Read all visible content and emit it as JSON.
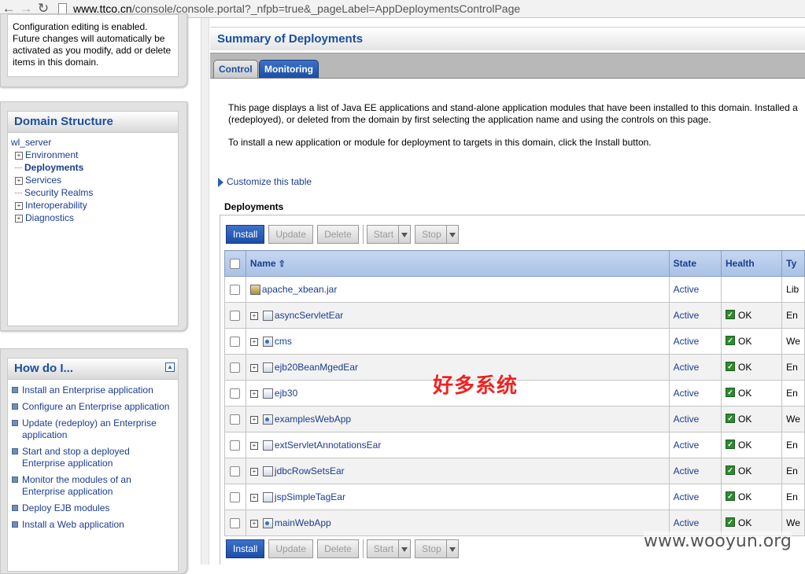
{
  "browser": {
    "back_icon": "arrow-left-icon",
    "forward_icon": "arrow-right-icon",
    "reload_icon": "reload-icon",
    "url_host": "www.ttco.cn",
    "url_path": "/console/console.portal?_nfpb=true&_pageLabel=AppDeploymentsControlPage"
  },
  "change_center": {
    "text": "Configuration editing is enabled. Future changes will automatically be activated as you modify, add or delete items in this domain."
  },
  "domain_structure": {
    "title": "Domain Structure",
    "root": "wl_server",
    "items": [
      {
        "label": "Environment",
        "expandable": true
      },
      {
        "label": "Deployments",
        "expandable": false,
        "selected": true
      },
      {
        "label": "Services",
        "expandable": true
      },
      {
        "label": "Security Realms",
        "expandable": false
      },
      {
        "label": "Interoperability",
        "expandable": true
      },
      {
        "label": "Diagnostics",
        "expandable": true
      }
    ]
  },
  "how_do_i": {
    "title": "How do I...",
    "items": [
      "Install an Enterprise application",
      "Configure an Enterprise application",
      "Update (redeploy) an Enterprise application",
      "Start and stop a deployed Enterprise application",
      "Monitor the modules of an Enterprise application",
      "Deploy EJB modules",
      "Install a Web application"
    ]
  },
  "main": {
    "title": "Summary of Deployments",
    "tabs": [
      {
        "label": "Control",
        "active": false
      },
      {
        "label": "Monitoring",
        "active": true
      }
    ],
    "intro_line1": "This page displays a list of Java EE applications and stand-alone application modules that have been installed to this domain. Installed a",
    "intro_line2": "(redeployed), or deleted from the domain by first selecting the application name and using the controls on this page.",
    "intro_line3": "To install a new application or module for deployment to targets in this domain, click the Install button.",
    "customize_link": "Customize this table",
    "table_caption": "Deployments"
  },
  "toolbar": {
    "install": "Install",
    "update": "Update",
    "delete": "Delete",
    "start": "Start",
    "stop": "Stop"
  },
  "table": {
    "columns": {
      "name": "Name",
      "state": "State",
      "health": "Health",
      "type": "Ty"
    },
    "rows": [
      {
        "name": "apache_xbean.jar",
        "state": "Active",
        "health": "",
        "type": "Lib",
        "expandable": false,
        "icon": "library-icon"
      },
      {
        "name": "asyncServletEar",
        "state": "Active",
        "health": "OK",
        "type": "En",
        "expandable": true,
        "icon": "enterprise-app-icon"
      },
      {
        "name": "cms",
        "state": "Active",
        "health": "OK",
        "type": "We",
        "expandable": true,
        "icon": "web-app-icon"
      },
      {
        "name": "ejb20BeanMgedEar",
        "state": "Active",
        "health": "OK",
        "type": "En",
        "expandable": true,
        "icon": "enterprise-app-icon"
      },
      {
        "name": "ejb30",
        "state": "Active",
        "health": "OK",
        "type": "En",
        "expandable": true,
        "icon": "enterprise-app-icon"
      },
      {
        "name": "examplesWebApp",
        "state": "Active",
        "health": "OK",
        "type": "We",
        "expandable": true,
        "icon": "web-app-icon"
      },
      {
        "name": "extServletAnnotationsEar",
        "state": "Active",
        "health": "OK",
        "type": "En",
        "expandable": true,
        "icon": "enterprise-app-icon"
      },
      {
        "name": "jdbcRowSetsEar",
        "state": "Active",
        "health": "OK",
        "type": "En",
        "expandable": true,
        "icon": "enterprise-app-icon"
      },
      {
        "name": "jspSimpleTagEar",
        "state": "Active",
        "health": "OK",
        "type": "En",
        "expandable": true,
        "icon": "enterprise-app-icon"
      },
      {
        "name": "mainWebApp",
        "state": "Active",
        "health": "OK",
        "type": "We",
        "expandable": true,
        "icon": "web-app-icon"
      }
    ]
  },
  "overlay": {
    "annotation_cn": "好多系统",
    "watermark": "www.wooyun.org"
  }
}
